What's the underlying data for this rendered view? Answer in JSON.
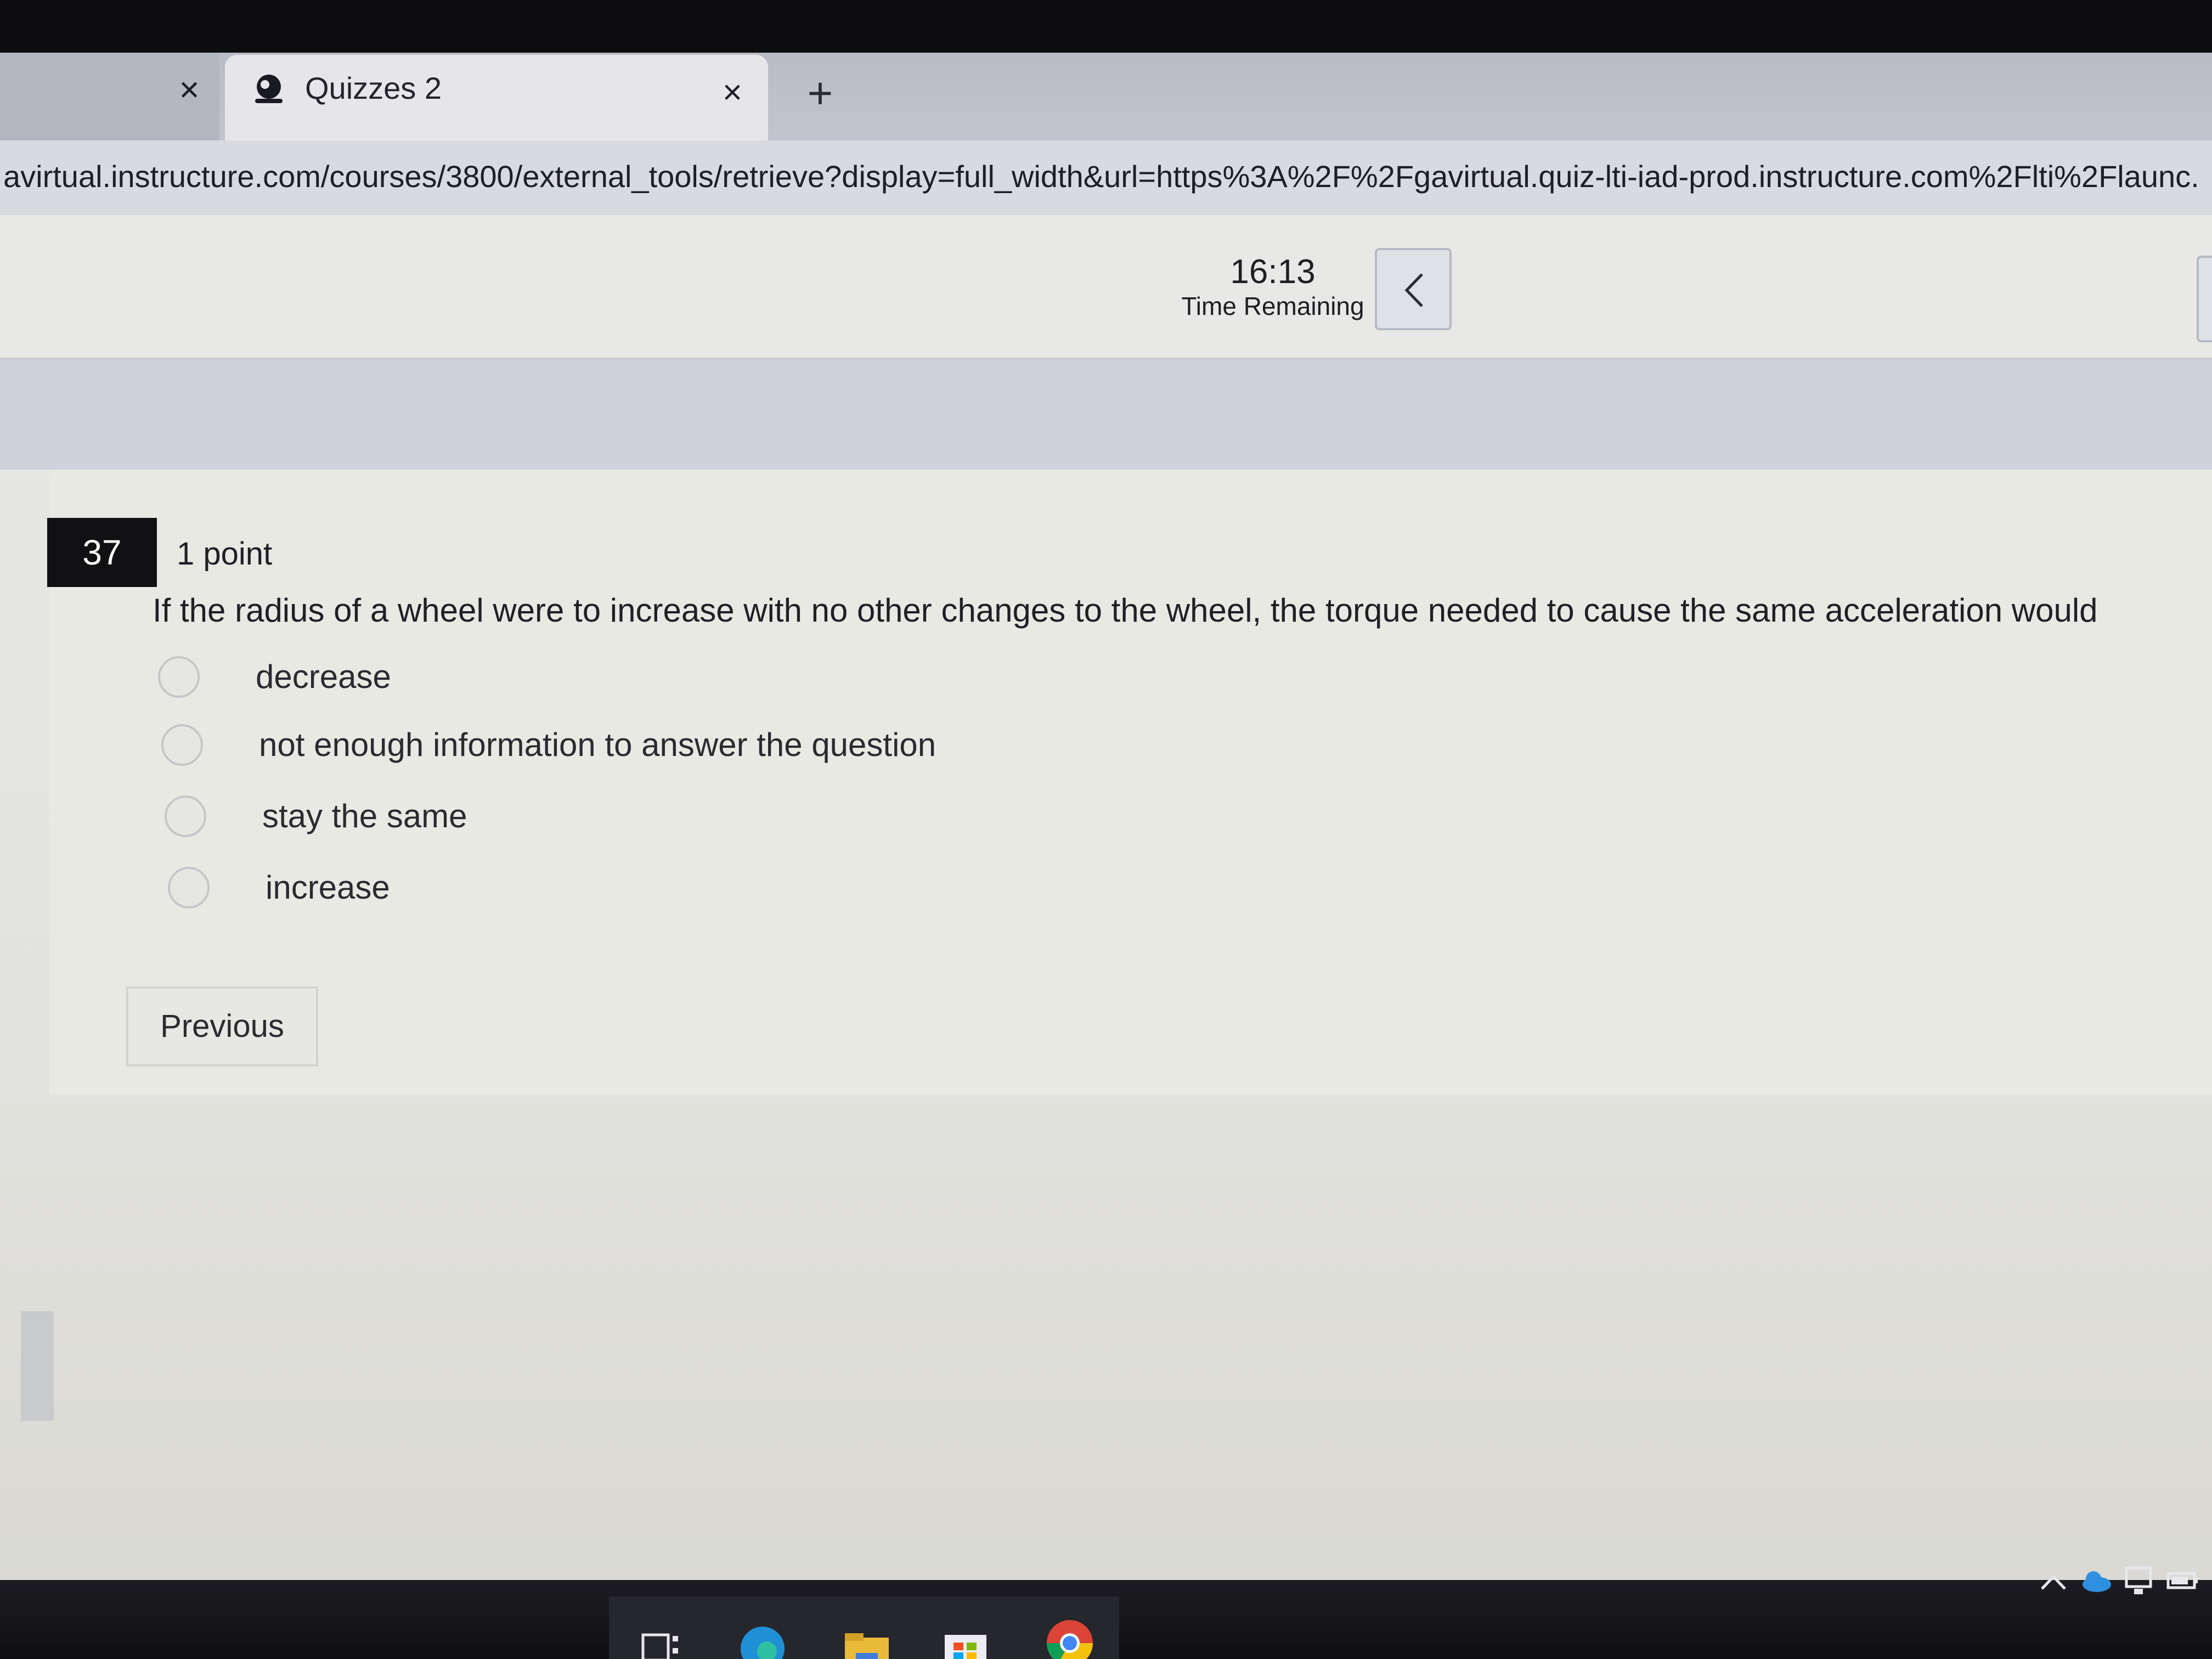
{
  "browser": {
    "prev_tab_close": "×",
    "active_tab": {
      "title": "Quizzes 2",
      "close": "×"
    },
    "new_tab": "+",
    "url": "avirtual.instructure.com/courses/3800/external_tools/retrieve?display=full_width&url=https%3A%2F%2Fgavirtual.quiz-lti-iad-prod.instructure.com%2Flti%2Flaunc..."
  },
  "timer": {
    "value": "16:13",
    "label": "Time Remaining"
  },
  "question": {
    "number": "37",
    "points": "1 point",
    "text": "If the radius of a wheel were to increase with no other changes to the wheel, the torque needed to cause the same acceleration would",
    "options": [
      {
        "label": "decrease"
      },
      {
        "label": "not enough information to answer the question"
      },
      {
        "label": "stay the same"
      },
      {
        "label": "increase"
      }
    ]
  },
  "navigation": {
    "previous_label": "Previous"
  },
  "colors": {
    "qnum_bg": "#111114",
    "page_bg": "#e7e7e3",
    "taskbar": "#0e0e12"
  }
}
